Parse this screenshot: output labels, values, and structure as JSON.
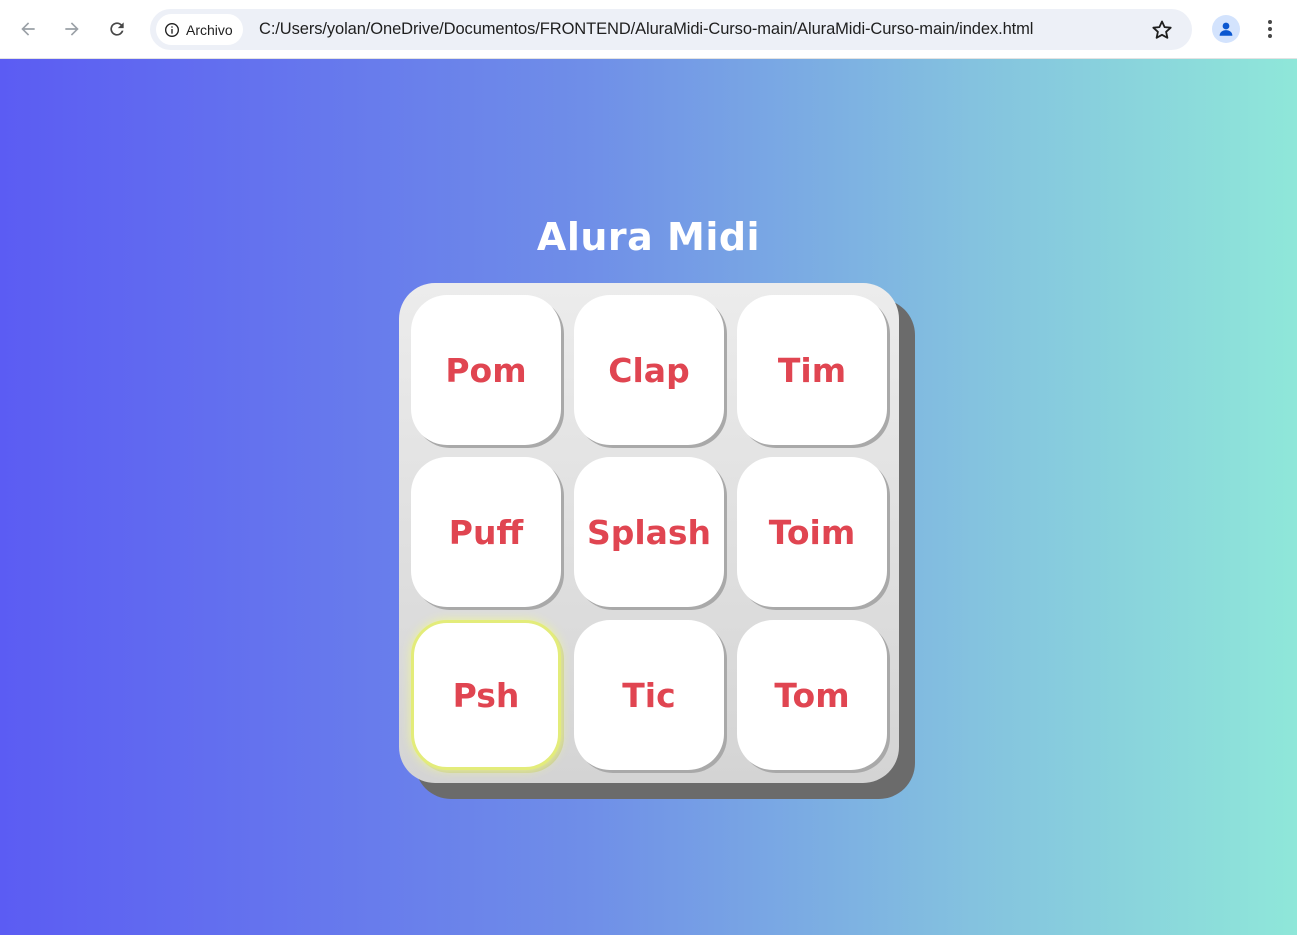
{
  "browser": {
    "chip_label": "Archivo",
    "url": "C:/Users/yolan/OneDrive/Documentos/FRONTEND/AluraMidi-Curso-main/AluraMidi-Curso-main/index.html"
  },
  "page": {
    "title": "Alura Midi",
    "keys": [
      "Pom",
      "Clap",
      "Tim",
      "Puff",
      "Splash",
      "Toim",
      "Psh",
      "Tic",
      "Tom"
    ],
    "active_key": "Psh"
  },
  "colors": {
    "key_text": "#e04551",
    "gradient_start": "#5b5cf3",
    "gradient_end": "#8fe7d9",
    "active_outline": "#e3ec7a"
  }
}
